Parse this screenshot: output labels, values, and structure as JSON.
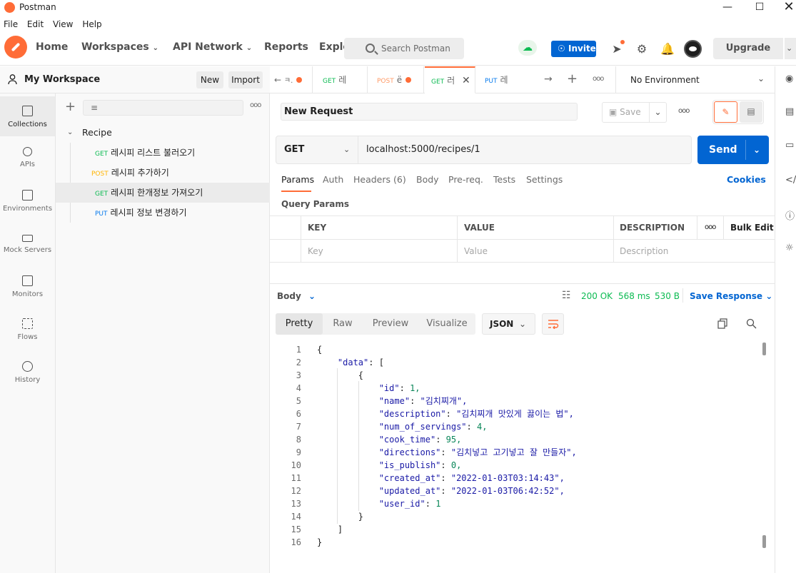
{
  "window": {
    "title": "Postman"
  },
  "menu": [
    "File",
    "Edit",
    "View",
    "Help"
  ],
  "header": {
    "home": "Home",
    "workspaces": "Workspaces",
    "api_network": "API Network",
    "reports": "Reports",
    "explore": "Explo",
    "search_placeholder": "Search Postman",
    "invite": "Invite",
    "upgrade": "Upgrade"
  },
  "workspace": {
    "name": "My Workspace",
    "new_label": "New",
    "import_label": "Import"
  },
  "rail": [
    {
      "label": "Collections",
      "icon": "collections-icon"
    },
    {
      "label": "APIs",
      "icon": "apis-icon"
    },
    {
      "label": "Environments",
      "icon": "environments-icon"
    },
    {
      "label": "Mock Servers",
      "icon": "mock-servers-icon"
    },
    {
      "label": "Monitors",
      "icon": "monitors-icon"
    },
    {
      "label": "Flows",
      "icon": "flows-icon"
    },
    {
      "label": "History",
      "icon": "history-icon"
    }
  ],
  "collection": {
    "name": "Recipe",
    "requests": [
      {
        "method": "GET",
        "name": "레시피 리스트 불러오기"
      },
      {
        "method": "POST",
        "name": "레시피 추가하기"
      },
      {
        "method": "GET",
        "name": "레시피 한개정보 가져오기"
      },
      {
        "method": "PUT",
        "name": "레시피 정보 변경하기"
      }
    ]
  },
  "tabs": [
    {
      "method": "",
      "label": "ㅋ."
    },
    {
      "method": "GET",
      "label": "레"
    },
    {
      "method": "POST",
      "label": "ё"
    },
    {
      "method": "GET",
      "label": "러"
    },
    {
      "method": "PUT",
      "label": "레"
    }
  ],
  "environment": "No Environment",
  "request": {
    "name": "New Request",
    "save_label": "Save",
    "method": "GET",
    "url": "localhost:5000/recipes/1",
    "send_label": "Send",
    "subtabs": [
      "Params",
      "Auth",
      "Headers (6)",
      "Body",
      "Pre-req.",
      "Tests",
      "Settings"
    ],
    "cookies_label": "Cookies",
    "query_params_title": "Query Params",
    "params_headers": {
      "key": "KEY",
      "value": "VALUE",
      "description": "DESCRIPTION",
      "bulk_edit": "Bulk Edit"
    },
    "params_placeholders": {
      "key": "Key",
      "value": "Value",
      "description": "Description"
    }
  },
  "response": {
    "body_label": "Body",
    "status": "200 OK",
    "time": "568 ms",
    "size": "530 B",
    "save_response": "Save Response",
    "view_modes": [
      "Pretty",
      "Raw",
      "Preview",
      "Visualize"
    ],
    "format": "JSON",
    "code_lines": [
      "{",
      "    \"data\": [",
      "        {",
      "            \"id\": 1,",
      "            \"name\": \"김치찌개\",",
      "            \"description\": \"김치찌개 맛있게 끓이는 법\",",
      "            \"num_of_servings\": 4,",
      "            \"cook_time\": 95,",
      "            \"directions\": \"김치넣고 고기넣고 잘 만들자\",",
      "            \"is_publish\": 0,",
      "            \"created_at\": \"2022-01-03T03:14:43\",",
      "            \"updated_at\": \"2022-01-03T06:42:52\",",
      "            \"user_id\": 1",
      "        }",
      "    ]",
      "}"
    ]
  }
}
